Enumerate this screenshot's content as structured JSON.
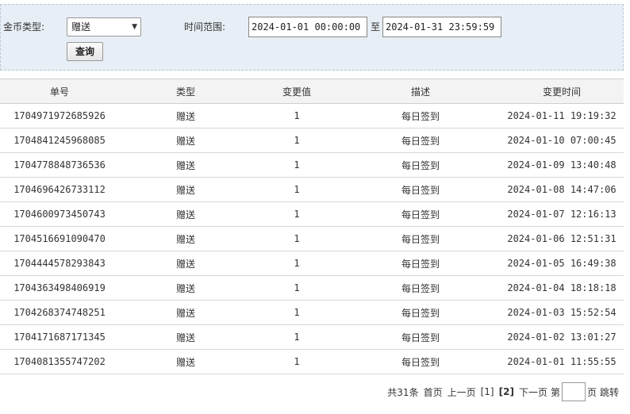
{
  "filter": {
    "coin_type_label": "金币类型:",
    "coin_type_value": "赠送",
    "time_range_label": "时间范围:",
    "start_time": "2024-01-01 00:00:00",
    "to_label": "至",
    "end_time": "2024-01-31 23:59:59",
    "query_button": "查询"
  },
  "table": {
    "headers": [
      "单号",
      "类型",
      "变更值",
      "描述",
      "变更时间"
    ],
    "rows": [
      [
        "1704971972685926",
        "赠送",
        "1",
        "每日签到",
        "2024-01-11 19:19:32"
      ],
      [
        "1704841245968085",
        "赠送",
        "1",
        "每日签到",
        "2024-01-10 07:00:45"
      ],
      [
        "1704778848736536",
        "赠送",
        "1",
        "每日签到",
        "2024-01-09 13:40:48"
      ],
      [
        "1704696426733112",
        "赠送",
        "1",
        "每日签到",
        "2024-01-08 14:47:06"
      ],
      [
        "1704600973450743",
        "赠送",
        "1",
        "每日签到",
        "2024-01-07 12:16:13"
      ],
      [
        "1704516691090470",
        "赠送",
        "1",
        "每日签到",
        "2024-01-06 12:51:31"
      ],
      [
        "1704444578293843",
        "赠送",
        "1",
        "每日签到",
        "2024-01-05 16:49:38"
      ],
      [
        "1704363498406919",
        "赠送",
        "1",
        "每日签到",
        "2024-01-04 18:18:18"
      ],
      [
        "1704268374748251",
        "赠送",
        "1",
        "每日签到",
        "2024-01-03 15:52:54"
      ],
      [
        "1704171687171345",
        "赠送",
        "1",
        "每日签到",
        "2024-01-02 13:01:27"
      ],
      [
        "1704081355747202",
        "赠送",
        "1",
        "每日签到",
        "2024-01-01 11:55:55"
      ]
    ]
  },
  "pagination": {
    "total": "共31条",
    "first": "首页",
    "prev": "上一页",
    "page1": "[1]",
    "page2": "[2]",
    "next": "下一页",
    "goto_prefix": "第",
    "goto_suffix": "页",
    "jump": "跳转"
  }
}
